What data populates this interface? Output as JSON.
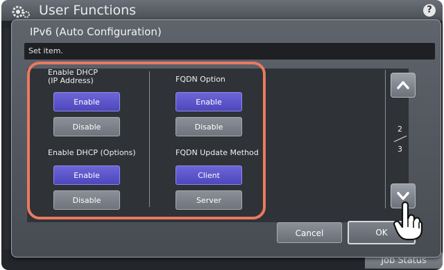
{
  "app": {
    "title": "User Functions",
    "help_label": "?"
  },
  "footer": {
    "job_status_label": "Job Status"
  },
  "dialog": {
    "title": "IPv6 (Auto Configuration)",
    "message": "Set item.",
    "groups": [
      {
        "label": "Enable DHCP\n(IP Address)",
        "options": [
          "Enable",
          "Disable"
        ],
        "selected": "Enable"
      },
      {
        "label": "FQDN Option",
        "options": [
          "Enable",
          "Disable"
        ],
        "selected": "Enable"
      },
      {
        "label": "Enable DHCP (Options)",
        "options": [
          "Enable",
          "Disable"
        ],
        "selected": "Enable"
      },
      {
        "label": "FQDN Update Method",
        "options": [
          "Client",
          "Server"
        ],
        "selected": "Client"
      }
    ],
    "pagination": {
      "current": "2",
      "total": "3"
    },
    "cancel_label": "Cancel",
    "ok_label": "OK"
  },
  "icons": {
    "gear": "gear-icon",
    "help": "help-icon",
    "up": "chevron-up-icon",
    "down": "chevron-down-icon",
    "pointer": "hand-pointer-icon"
  },
  "colors": {
    "selected": "#5a53c8",
    "highlight": "#e97a60",
    "background": "#23262b"
  }
}
